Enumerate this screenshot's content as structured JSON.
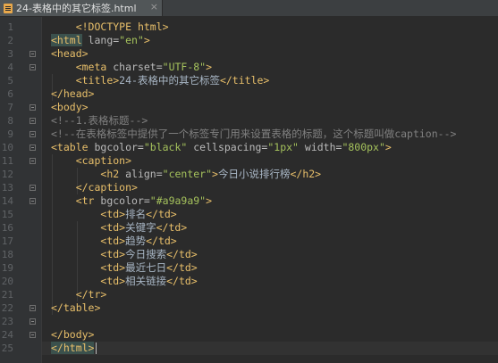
{
  "tab": {
    "title": "24-表格中的其它标签.html",
    "close_glyph": "×"
  },
  "gutter": {
    "line_numbers": [
      "1",
      "2",
      "3",
      "4",
      "5",
      "6",
      "7",
      "8",
      "9",
      "10",
      "11",
      "12",
      "13",
      "14",
      "15",
      "16",
      "17",
      "18",
      "19",
      "20",
      "21",
      "22",
      "23",
      "24",
      "25"
    ]
  },
  "code": {
    "l1": "<!DOCTYPE html>",
    "l2_a": "<html",
    "l2_b": " lang=",
    "l2_c": "\"en\"",
    "l2_d": ">",
    "l3": "<head>",
    "l4_a": "<meta",
    "l4_b": " charset=",
    "l4_c": "\"UTF-8\"",
    "l4_d": ">",
    "l5_a": "<title>",
    "l5_b": "24-表格中的其它标签",
    "l5_c": "</title>",
    "l6": "</head>",
    "l7": "<body>",
    "l8": "<!--1.表格标题-->",
    "l9": "<!--在表格标签中提供了一个标签专门用来设置表格的标题，这个标题叫做caption-->",
    "l10_a": "<table",
    "l10_b": " bgcolor=",
    "l10_c": "\"black\"",
    "l10_d": " cellspacing=",
    "l10_e": "\"1px\"",
    "l10_f": " width=",
    "l10_g": "\"800px\"",
    "l10_h": ">",
    "l11": "<caption>",
    "l12_a": "<h2",
    "l12_b": " align=",
    "l12_c": "\"center\"",
    "l12_d": ">",
    "l12_e": "今日小说排行榜",
    "l12_f": "</h2>",
    "l13": "</caption>",
    "l14_a": "<tr",
    "l14_b": " bgcolor=",
    "l14_c": "\"#a9a9a9\"",
    "l14_d": ">",
    "l15_a": "<td>",
    "l15_b": "排名",
    "l15_c": "</td>",
    "l16_a": "<td>",
    "l16_b": "关键字",
    "l16_c": "</td>",
    "l17_a": "<td>",
    "l17_b": "趋势",
    "l17_c": "</td>",
    "l18_a": "<td>",
    "l18_b": "今日搜索",
    "l18_c": "</td>",
    "l19_a": "<td>",
    "l19_b": "最近七日",
    "l19_c": "</td>",
    "l20_a": "<td>",
    "l20_b": "相关链接",
    "l20_c": "</td>",
    "l21": "</tr>",
    "l22": "</table>",
    "l24": "</body>",
    "l25_a": "</html",
    "l25_b": ">"
  },
  "colors": {
    "background": "#2b2b2b",
    "tag": "#e8bf6a",
    "attribute": "#bababa",
    "string": "#a5c25c",
    "comment": "#808080",
    "text": "#a9b7c6"
  }
}
